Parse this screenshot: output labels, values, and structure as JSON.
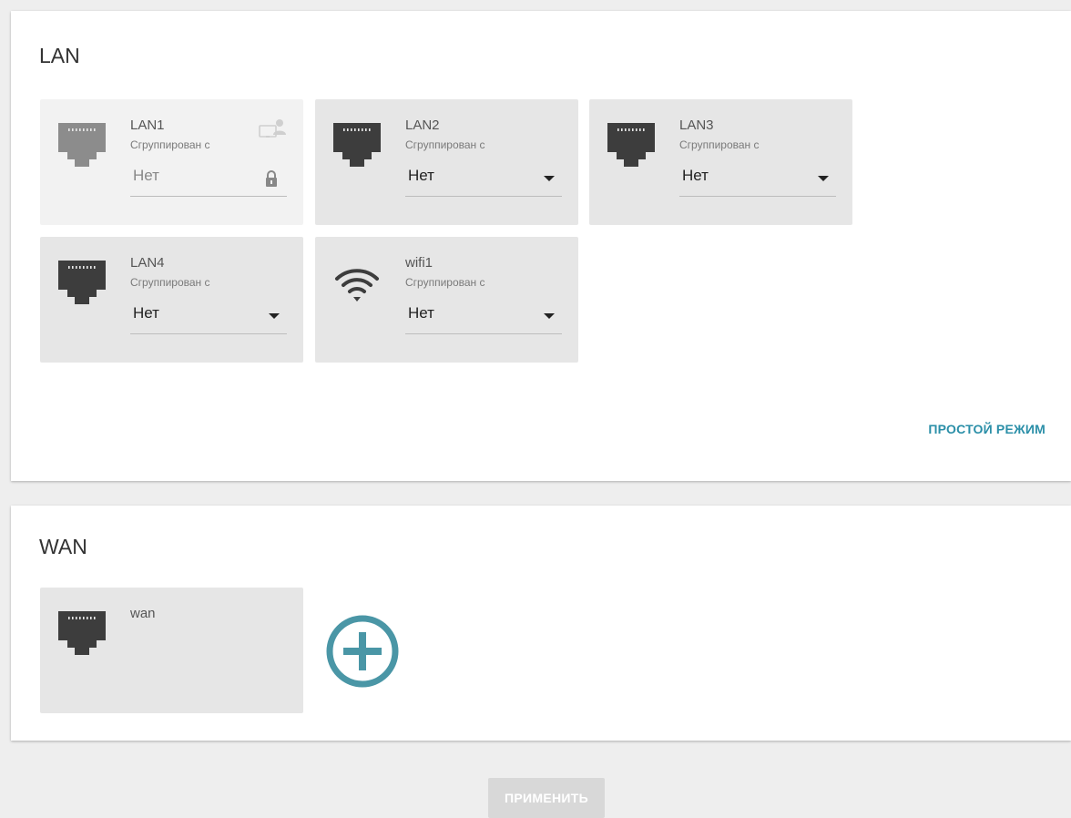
{
  "lan": {
    "title": "LAN",
    "ports": [
      {
        "name": "LAN1",
        "sub": "Сгруппирован с",
        "value": "Нет",
        "locked": true
      },
      {
        "name": "LAN2",
        "sub": "Сгруппирован с",
        "value": "Нет",
        "locked": false
      },
      {
        "name": "LAN3",
        "sub": "Сгруппирован с",
        "value": "Нет",
        "locked": false
      },
      {
        "name": "LAN4",
        "sub": "Сгруппирован с",
        "value": "Нет",
        "locked": false
      },
      {
        "name": "wifi1",
        "sub": "Сгруппирован с",
        "value": "Нет",
        "locked": false,
        "icon": "wifi-icon"
      }
    ],
    "simple_mode_label": "ПРОСТОЙ РЕЖИМ"
  },
  "wan": {
    "title": "WAN",
    "ports": [
      {
        "name": "wan"
      }
    ],
    "add_icon": "add-circle-icon"
  },
  "apply_label": "ПРИМЕНИТЬ",
  "colors": {
    "accent": "#2b8fa8",
    "add_icon": "#4a96a6",
    "card_bg": "#e6e6e6",
    "card_locked_bg": "#f2f2f2",
    "port_icon": "#3d3d3d",
    "port_icon_locked": "#8c8c8c",
    "apply_disabled_bg": "#d8d8d8"
  }
}
